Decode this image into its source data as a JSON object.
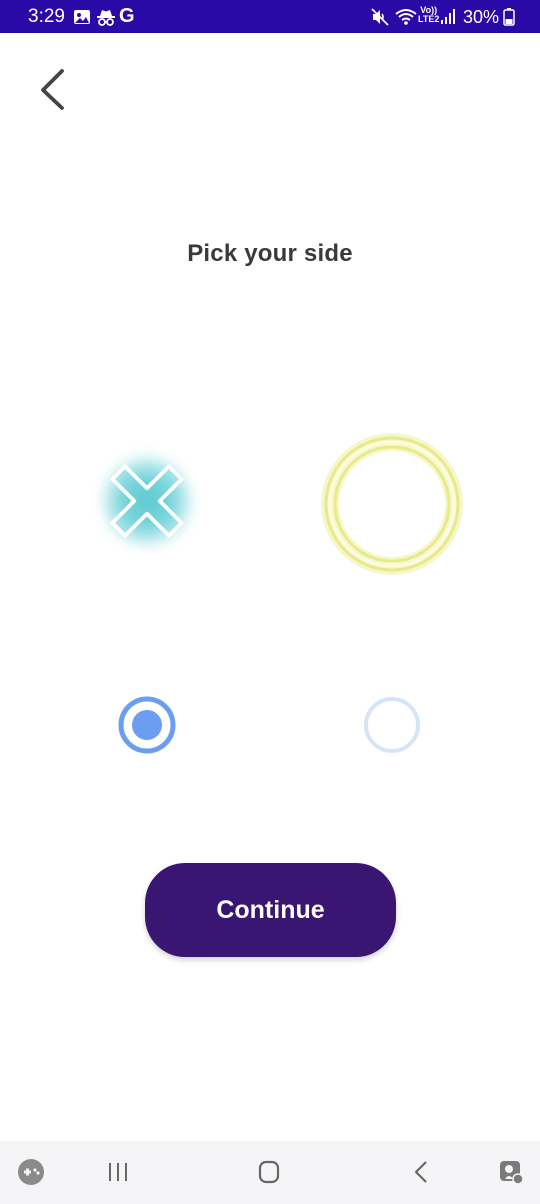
{
  "status_bar": {
    "time": "3:29",
    "carrier_letter": "G",
    "network_top": "Vo))",
    "network_bottom": "LTE2",
    "battery": "30%",
    "icons": [
      "image-icon",
      "incognito-icon",
      "google-icon",
      "mute-icon",
      "wifi-icon",
      "volte-icon",
      "signal-icon",
      "battery-icon"
    ],
    "background": "#2a0aa6"
  },
  "header": {
    "back_icon": "back-arrow-icon"
  },
  "page": {
    "title": "Pick your side"
  },
  "sides": [
    {
      "icon": "x-mark-icon",
      "color": "#48c3cc",
      "selected": true
    },
    {
      "icon": "o-ring-icon",
      "color": "#eded9a",
      "selected": false
    }
  ],
  "actions": {
    "continue_label": "Continue",
    "continue_color": "#3a1673"
  },
  "radio_colors": {
    "active": "#6b9ef0",
    "inactive": "#d6e4f7"
  },
  "nav_bar": {
    "icons": [
      "game-launcher-icon",
      "recents-icon",
      "home-icon",
      "back-icon",
      "assistant-icon"
    ]
  }
}
